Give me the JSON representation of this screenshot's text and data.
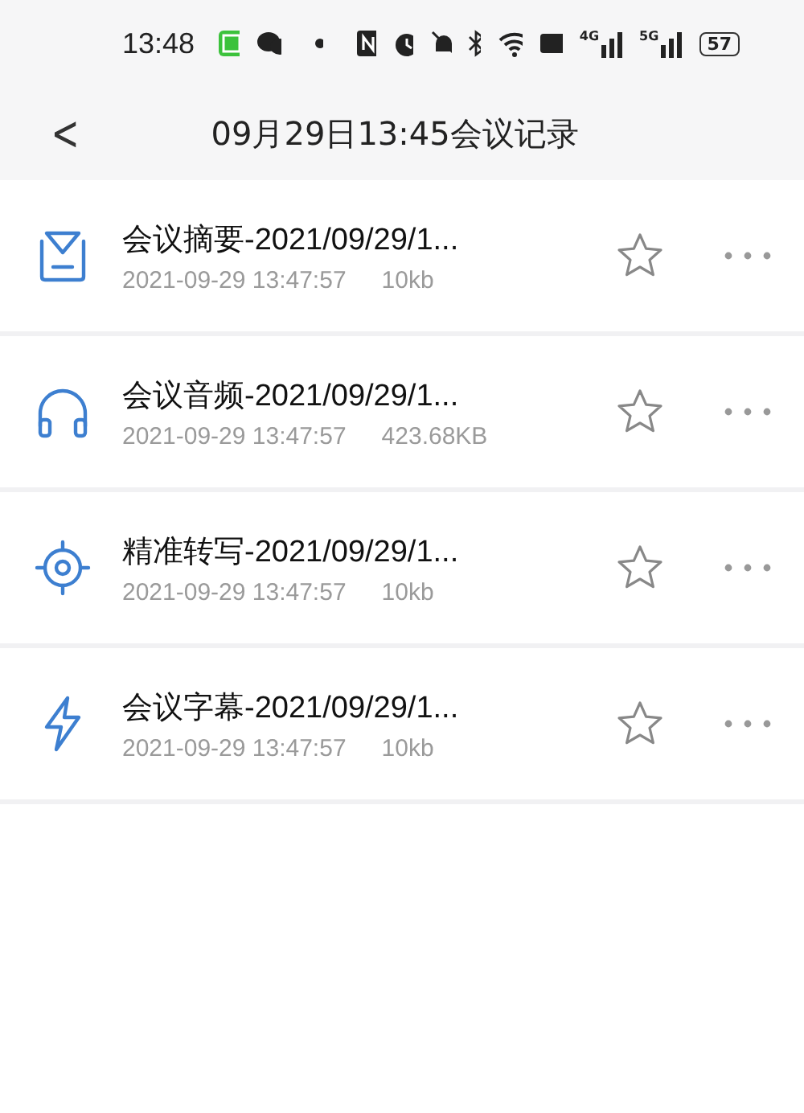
{
  "status_bar": {
    "time": "13:48",
    "network_1": "4G",
    "network_2": "5G",
    "battery": "57"
  },
  "header": {
    "back": "<",
    "title": "09月29日13:45会议记录"
  },
  "files": [
    {
      "kind": "summary",
      "name": "会议摘要-2021/09/29/1...",
      "date": "2021-09-29 13:47:57",
      "size": "10kb",
      "starred": false
    },
    {
      "kind": "audio",
      "name": "会议音频-2021/09/29/1...",
      "date": "2021-09-29 13:47:57",
      "size": "423.68KB",
      "starred": false
    },
    {
      "kind": "transcript",
      "name": "精准转写-2021/09/29/1...",
      "date": "2021-09-29 13:47:57",
      "size": "10kb",
      "starred": false
    },
    {
      "kind": "subtitle",
      "name": "会议字幕-2021/09/29/1...",
      "date": "2021-09-29 13:47:57",
      "size": "10kb",
      "starred": false
    }
  ]
}
